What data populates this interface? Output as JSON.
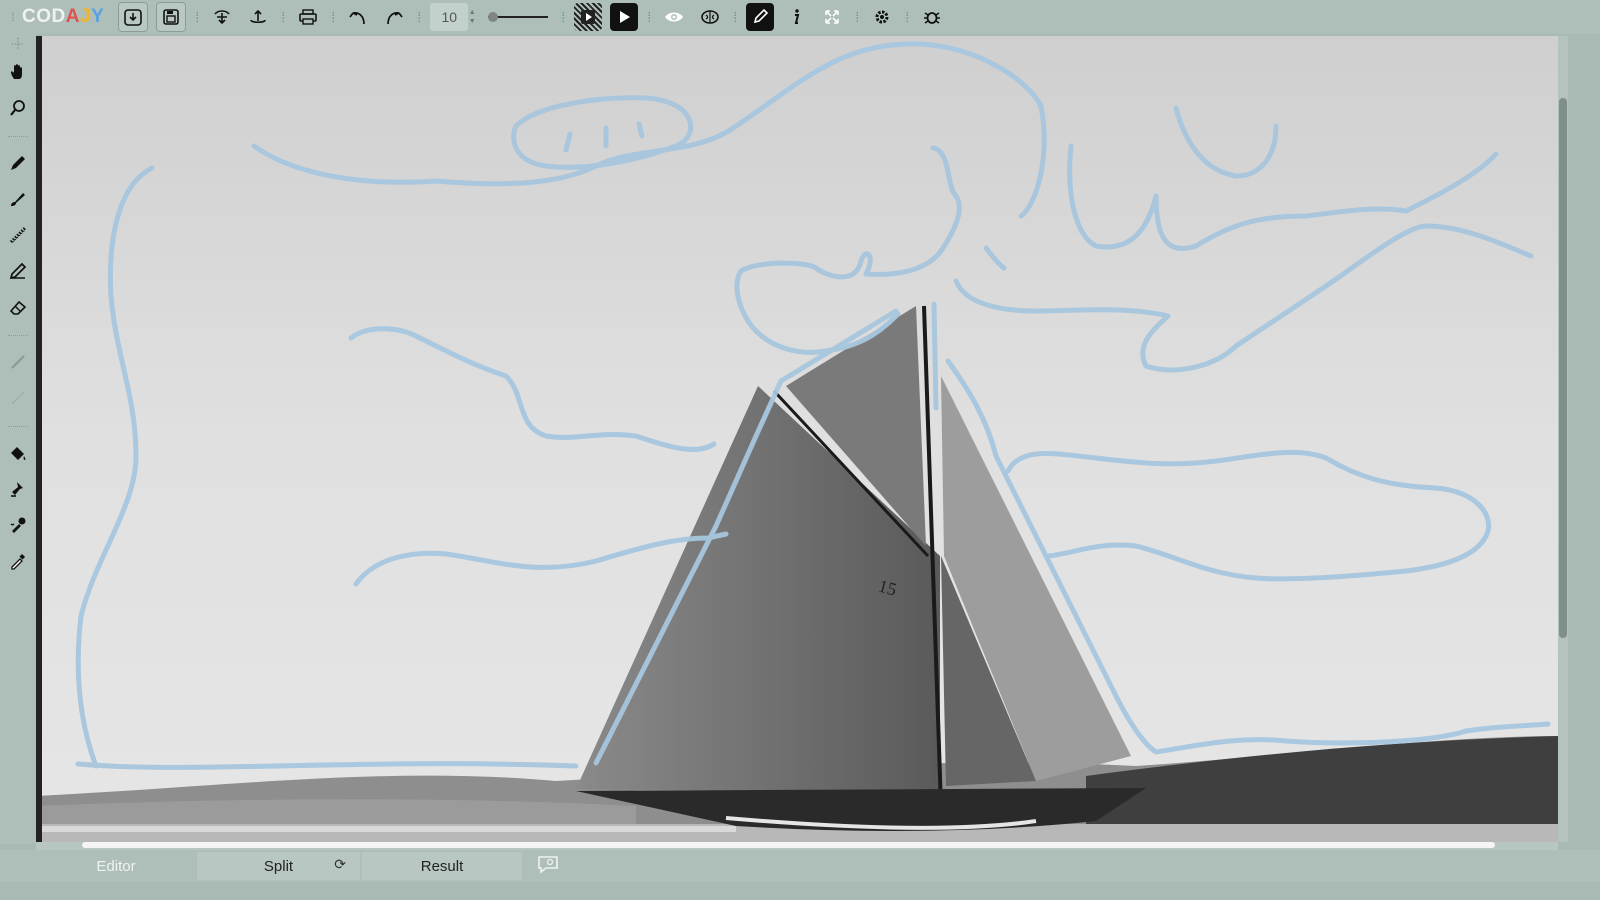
{
  "app": {
    "logo": {
      "letters": [
        "C",
        "O",
        "D",
        "A",
        "J",
        "Y"
      ],
      "colors": [
        "#e9eef0",
        "#e9eef0",
        "#e9eef0",
        "#e0524c",
        "#f0b429",
        "#5aa0e0"
      ]
    }
  },
  "toolbar": {
    "brush_size": "10",
    "buttons": [
      "download-icon",
      "save-image-icon",
      "layers-icon",
      "upload-icon",
      "print-icon",
      "undo-icon",
      "redo-icon",
      "play-icon",
      "eye-icon",
      "brain-icon",
      "pen-icon",
      "info-icon",
      "fullscreen-icon",
      "settings-icon",
      "bug-icon"
    ]
  },
  "left_tools": [
    "hand-tool",
    "zoom-tool",
    "pen-tool",
    "brush-tool",
    "spray-tool",
    "pencil-tool",
    "eraser-tool",
    "line-tool",
    "ruler-tool",
    "fill-tool",
    "stamp-tool",
    "dropper-tool",
    "eyedropper-tool"
  ],
  "canvas": {
    "sail_number": "15",
    "stroke_color": "#a7c6de"
  },
  "tabs": {
    "editor": "Editor",
    "split": "Split",
    "result": "Result",
    "swap_glyph": "⟳"
  }
}
